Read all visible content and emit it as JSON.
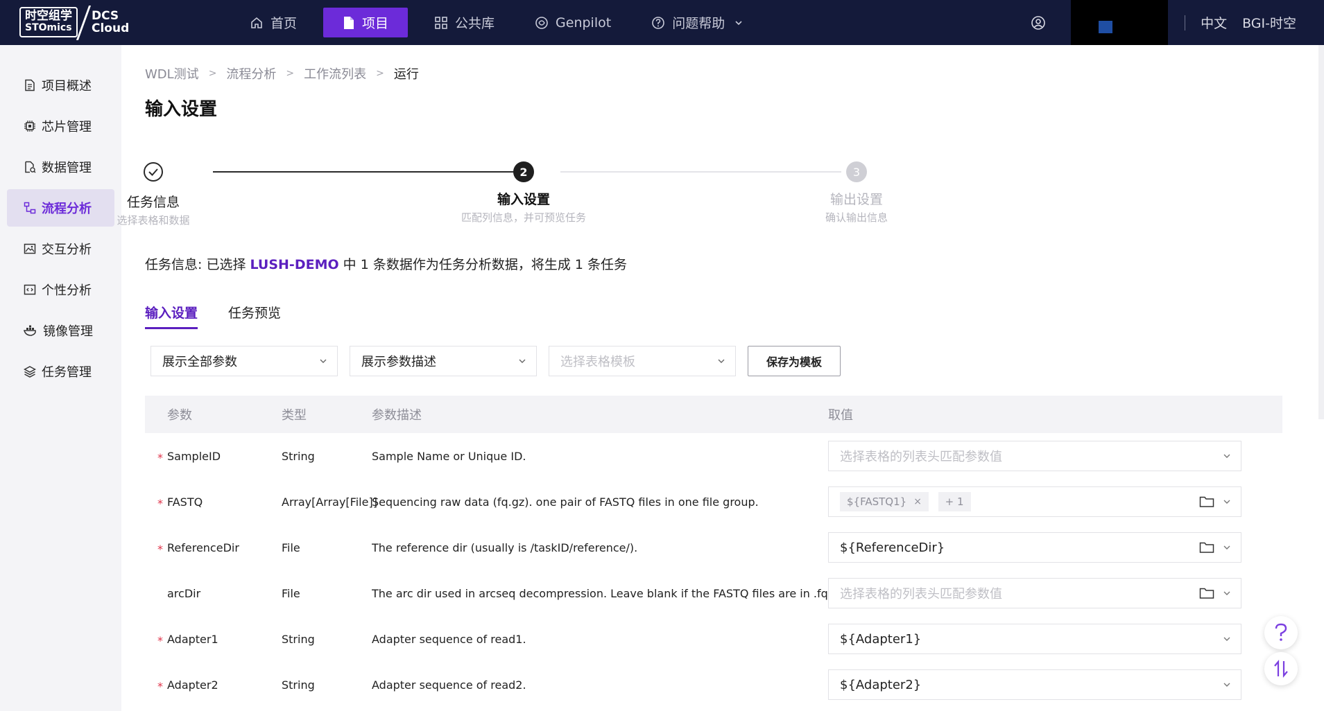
{
  "logo": {
    "cn": "时空组学",
    "en": "STOmics",
    "product_line1": "DCS",
    "product_line2": "Cloud"
  },
  "nav": [
    {
      "label": "首页",
      "icon": "home-icon"
    },
    {
      "label": "项目",
      "icon": "file-icon",
      "active": true
    },
    {
      "label": "公共库",
      "icon": "grid-icon"
    },
    {
      "label": "Genpilot",
      "icon": "genpilot-icon"
    },
    {
      "label": "问题帮助",
      "icon": "help-icon"
    }
  ],
  "header_right": {
    "language": "中文",
    "user": "BGI-时空"
  },
  "sidebar": [
    {
      "label": "项目概述",
      "icon": "document-icon"
    },
    {
      "label": "芯片管理",
      "icon": "chip-icon"
    },
    {
      "label": "数据管理",
      "icon": "data-file-icon"
    },
    {
      "label": "流程分析",
      "icon": "workflow-icon",
      "active": true
    },
    {
      "label": "交互分析",
      "icon": "image-icon"
    },
    {
      "label": "个性分析",
      "icon": "code-icon"
    },
    {
      "label": "镜像管理",
      "icon": "docker-icon"
    },
    {
      "label": "任务管理",
      "icon": "layers-icon"
    }
  ],
  "breadcrumb": [
    "WDL测试",
    "流程分析",
    "工作流列表",
    "运行"
  ],
  "page_title": "输入设置",
  "steps": [
    {
      "num": "1",
      "title": "任务信息",
      "desc": "选择表格和数据",
      "status": "done"
    },
    {
      "num": "2",
      "title": "输入设置",
      "desc": "匹配列信息，并可预览任务",
      "status": "current"
    },
    {
      "num": "3",
      "title": "输出设置",
      "desc": "确认输出信息",
      "status": "pending"
    }
  ],
  "task_info": {
    "prefix": "任务信息: 已选择 ",
    "project": "LUSH-DEMO",
    "suffix": " 中 1 条数据作为任务分析数据，将生成 1 条任务"
  },
  "tabs": [
    {
      "label": "输入设置",
      "active": true
    },
    {
      "label": "任务预览"
    }
  ],
  "filters": {
    "param_display": "展示全部参数",
    "desc_display": "展示参数描述",
    "template_placeholder": "选择表格模板",
    "save_template": "保存为模板"
  },
  "table": {
    "headers": [
      "参数",
      "类型",
      "参数描述",
      "取值"
    ],
    "value_placeholder": "选择表格的列表头匹配参数值",
    "rows": [
      {
        "required": true,
        "param": "SampleID",
        "type": "String",
        "desc": "Sample Name or Unique ID.",
        "value": "",
        "folder": false
      },
      {
        "required": true,
        "param": "FASTQ",
        "type": "Array[Array[File]]",
        "desc": "Sequencing raw data (fq.gz). one pair of FASTQ files in one file group.",
        "tags": [
          "${FASTQ1}"
        ],
        "more": "+ 1",
        "folder": true
      },
      {
        "required": true,
        "param": "ReferenceDir",
        "type": "File",
        "desc": "The reference dir (usually is /taskID/reference/).",
        "value": "${ReferenceDir}",
        "folder": true
      },
      {
        "required": false,
        "param": "arcDir",
        "type": "File",
        "desc": "The arc dir used in arcseq decompression. Leave blank if the FASTQ files are in .fq.gz ...",
        "value": "",
        "folder": true
      },
      {
        "required": true,
        "param": "Adapter1",
        "type": "String",
        "desc": "Adapter sequence of read1.",
        "value": "${Adapter1}",
        "folder": false
      },
      {
        "required": true,
        "param": "Adapter2",
        "type": "String",
        "desc": "Adapter sequence of read2.",
        "value": "${Adapter2}",
        "folder": false
      }
    ]
  },
  "colors": {
    "topbar": "#141a3a",
    "accent": "#6c2bd9",
    "required": "#e0344a"
  }
}
